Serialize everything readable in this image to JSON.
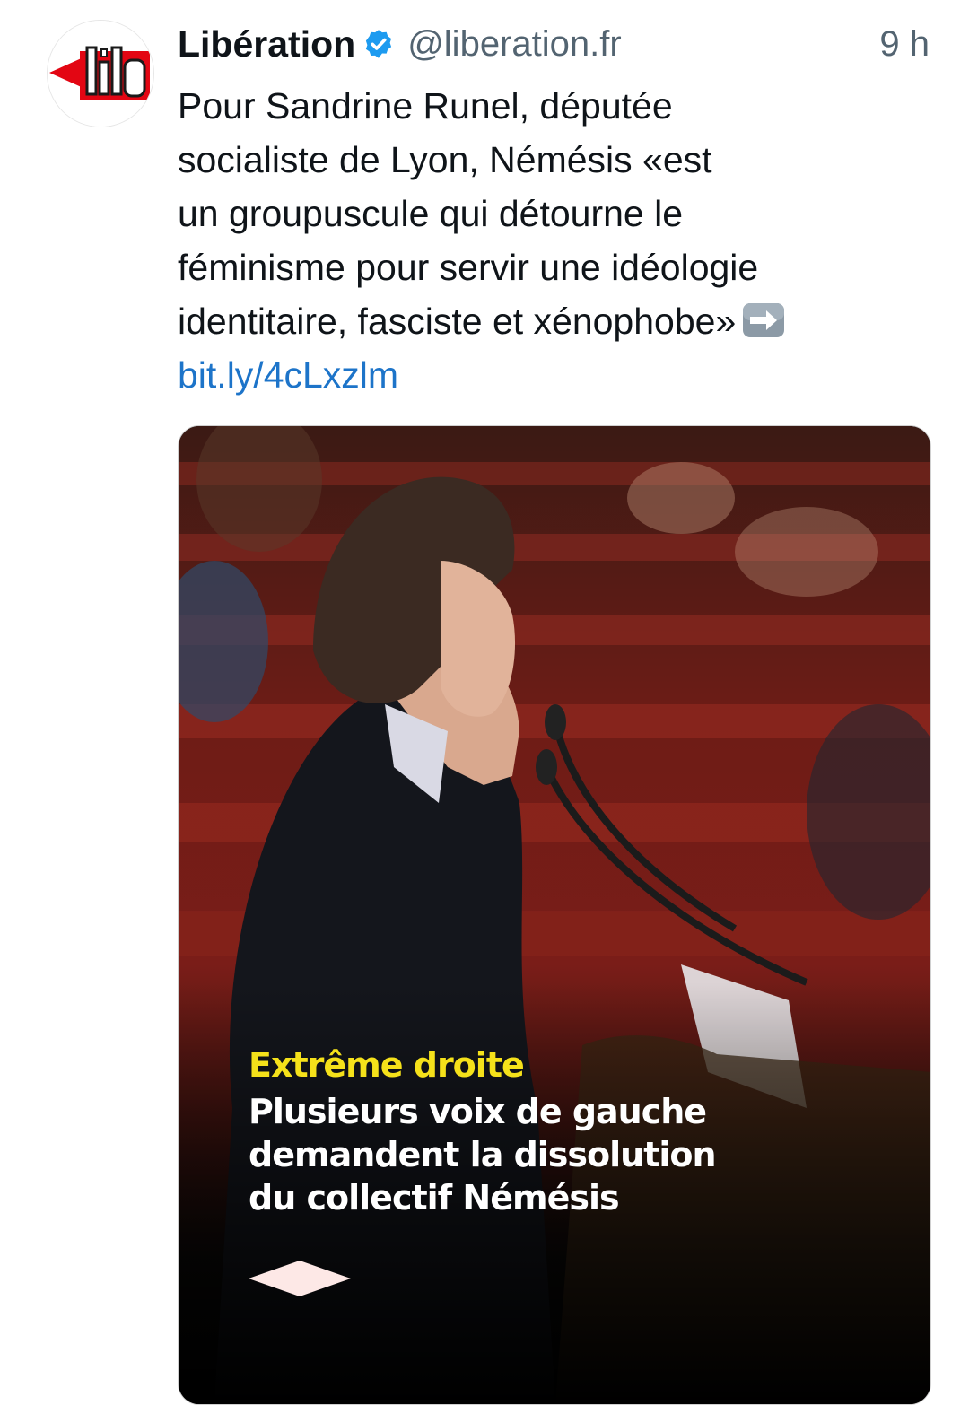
{
  "tweet": {
    "author": {
      "display_name": "Libération",
      "handle": "@liberation.fr",
      "avatar_icon": "libe-logo-icon",
      "verified_icon": "verified-badge-icon"
    },
    "timestamp": "9 h",
    "text_lines": [
      "Pour Sandrine Runel, députée",
      "socialiste de Lyon, Némésis «est",
      "un groupuscule qui détourne le",
      "féminisme pour servir une idéologie",
      "identitaire, fasciste et xénophobe»"
    ],
    "emoji": "right-arrow-emoji-icon",
    "link": "bit.ly/4cLxzlm",
    "media": {
      "kicker": "Extrême droite",
      "headline_lines": [
        "Plusieurs voix de gauche",
        "demandent la dissolution",
        "du collectif Némésis"
      ],
      "logo_icon": "diamond-logo-icon"
    }
  },
  "colors": {
    "link": "#1d74c9",
    "kicker": "#f5e11a",
    "verified": "#1d9bf0",
    "libe_red": "#e30613"
  }
}
